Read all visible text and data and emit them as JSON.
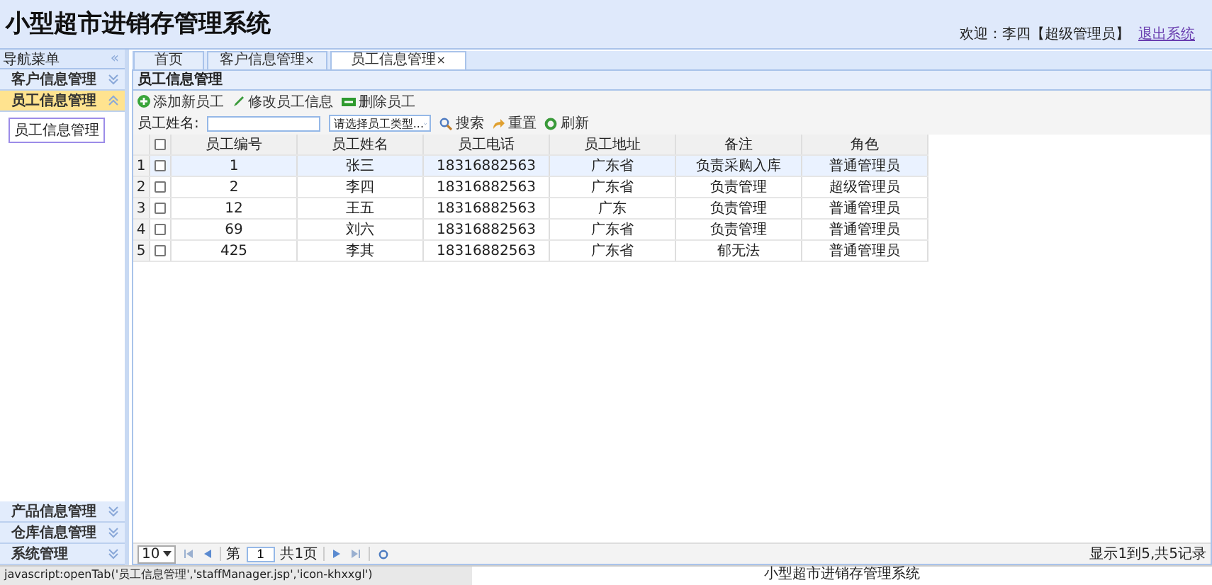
{
  "header": {
    "title": "小型超市进销存管理系统",
    "welcome": "欢迎：李四【超级管理员】",
    "logout": "退出系统"
  },
  "sidebar": {
    "title": "导航菜单",
    "collapse": "«",
    "sections": [
      {
        "label": "客户信息管理",
        "expanded": false,
        "selected": false
      },
      {
        "label": "员工信息管理",
        "expanded": true,
        "selected": true,
        "items": [
          {
            "label": "员工信息管理",
            "selected": true
          }
        ]
      },
      {
        "label": "产品信息管理",
        "expanded": false,
        "selected": false
      },
      {
        "label": "仓库信息管理",
        "expanded": false,
        "selected": false
      },
      {
        "label": "系统管理",
        "expanded": false,
        "selected": false
      }
    ]
  },
  "tabs": [
    {
      "label": "首页",
      "selected": false
    },
    {
      "label": "客户信息管理",
      "close": "×",
      "selected": false
    },
    {
      "label": "员工信息管理",
      "close": "×",
      "selected": true
    }
  ],
  "panel": {
    "title": "员工信息管理"
  },
  "toolbar": [
    {
      "kind": "add",
      "label": "添加新员工"
    },
    {
      "kind": "edit",
      "label": "修改员工信息"
    },
    {
      "kind": "delete",
      "label": "删除员工"
    }
  ],
  "search": {
    "label": "员工姓名:",
    "type_select": "请选择员工类型...",
    "buttons": [
      {
        "kind": "search",
        "label": "搜索"
      },
      {
        "kind": "reset",
        "label": "重置"
      },
      {
        "kind": "refresh",
        "label": "刷新"
      }
    ]
  },
  "table": {
    "select_all_checked": false,
    "columns": [
      "员工编号",
      "员工姓名",
      "员工电话",
      "员工地址",
      "备注",
      "角色"
    ],
    "rows": [
      {
        "num": "1",
        "checked": false,
        "selected": true,
        "cells": [
          "1",
          "张三",
          "18316882563",
          "广东省",
          "负责采购入库",
          "普通管理员"
        ]
      },
      {
        "num": "2",
        "checked": false,
        "selected": false,
        "cells": [
          "2",
          "李四",
          "18316882563",
          "广东省",
          "负责管理",
          "超级管理员"
        ]
      },
      {
        "num": "3",
        "checked": false,
        "selected": false,
        "cells": [
          "12",
          "王五",
          "18316882563",
          "广东",
          "负责管理",
          "普通管理员"
        ]
      },
      {
        "num": "4",
        "checked": false,
        "selected": false,
        "cells": [
          "69",
          "刘六",
          "18316882563",
          "广东省",
          "负责管理",
          "普通管理员"
        ]
      },
      {
        "num": "5",
        "checked": false,
        "selected": false,
        "cells": [
          "425",
          "李其",
          "18316882563",
          "广东省",
          "郁无法",
          "普通管理员"
        ]
      }
    ]
  },
  "pager": {
    "page_size": "10",
    "page_label": "第",
    "page": "1",
    "total_pages": "共1页",
    "info": "显示1到5,共5记录"
  },
  "status_bar": {
    "url": "javascript:openTab('员工信息管理','staffManager.jsp','icon-khxxgl')",
    "center": "小型超市进销存管理系统"
  }
}
